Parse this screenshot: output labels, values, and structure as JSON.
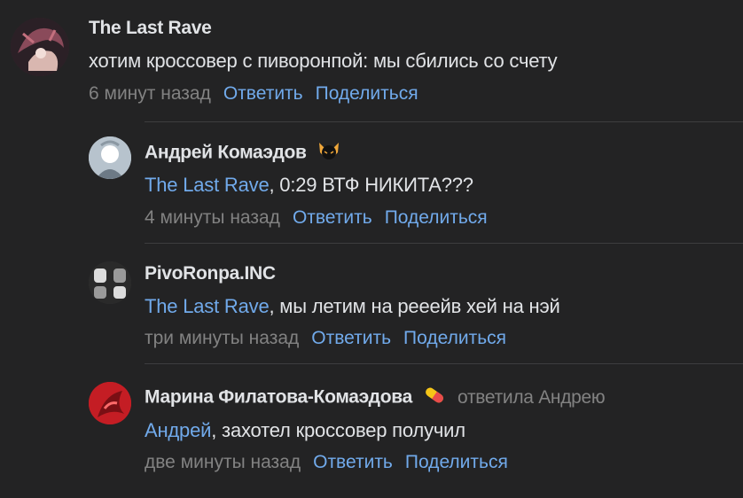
{
  "comments": [
    {
      "author": "The Last Rave",
      "mention": "",
      "text": "хотим кроссовер с пиворонпой: мы сбились со счету",
      "time": "6 минут назад",
      "reply": "Ответить",
      "share": "Поделиться",
      "avatar_colors": [
        "#8a4a5a",
        "#3b2a33",
        "#d9b7b0"
      ]
    },
    {
      "author": "Андрей Комаэдов",
      "mention": "The Last Rave",
      "text": ", 0:29 ВТФ НИКИТА???",
      "time": "4 минуты назад",
      "reply": "Ответить",
      "share": "Поделиться",
      "avatar_colors": [
        "#c9d4de",
        "#6d7a86",
        "#ffffff"
      ]
    },
    {
      "author": "PivoRonpa.INC",
      "mention": "The Last Rave",
      "text": ", мы летим на рееейв хей на нэй",
      "time": "три минуты назад",
      "reply": "Ответить",
      "share": "Поделиться",
      "avatar_colors": [
        "#9a9a9a",
        "#3a3a3a",
        "#dcdcdc"
      ]
    },
    {
      "author": "Марина Филатова-Комаэдова",
      "reply_to": "ответила Андрею",
      "mention": "Андрей",
      "text": ", захотел кроссовер получил",
      "time": "две минуты назад",
      "reply": "Ответить",
      "share": "Поделиться",
      "avatar_colors": [
        "#d8232a",
        "#7a0f14",
        "#ff6b6b"
      ]
    }
  ],
  "colors": {
    "background": "#232324",
    "text": "#e1e3e6",
    "link": "#71aaeb",
    "muted": "#828282",
    "divider": "#3d3d3f"
  },
  "icons": {
    "author_badge": "cat-face-icon",
    "author_emoji": "pill-emoji-icon"
  }
}
